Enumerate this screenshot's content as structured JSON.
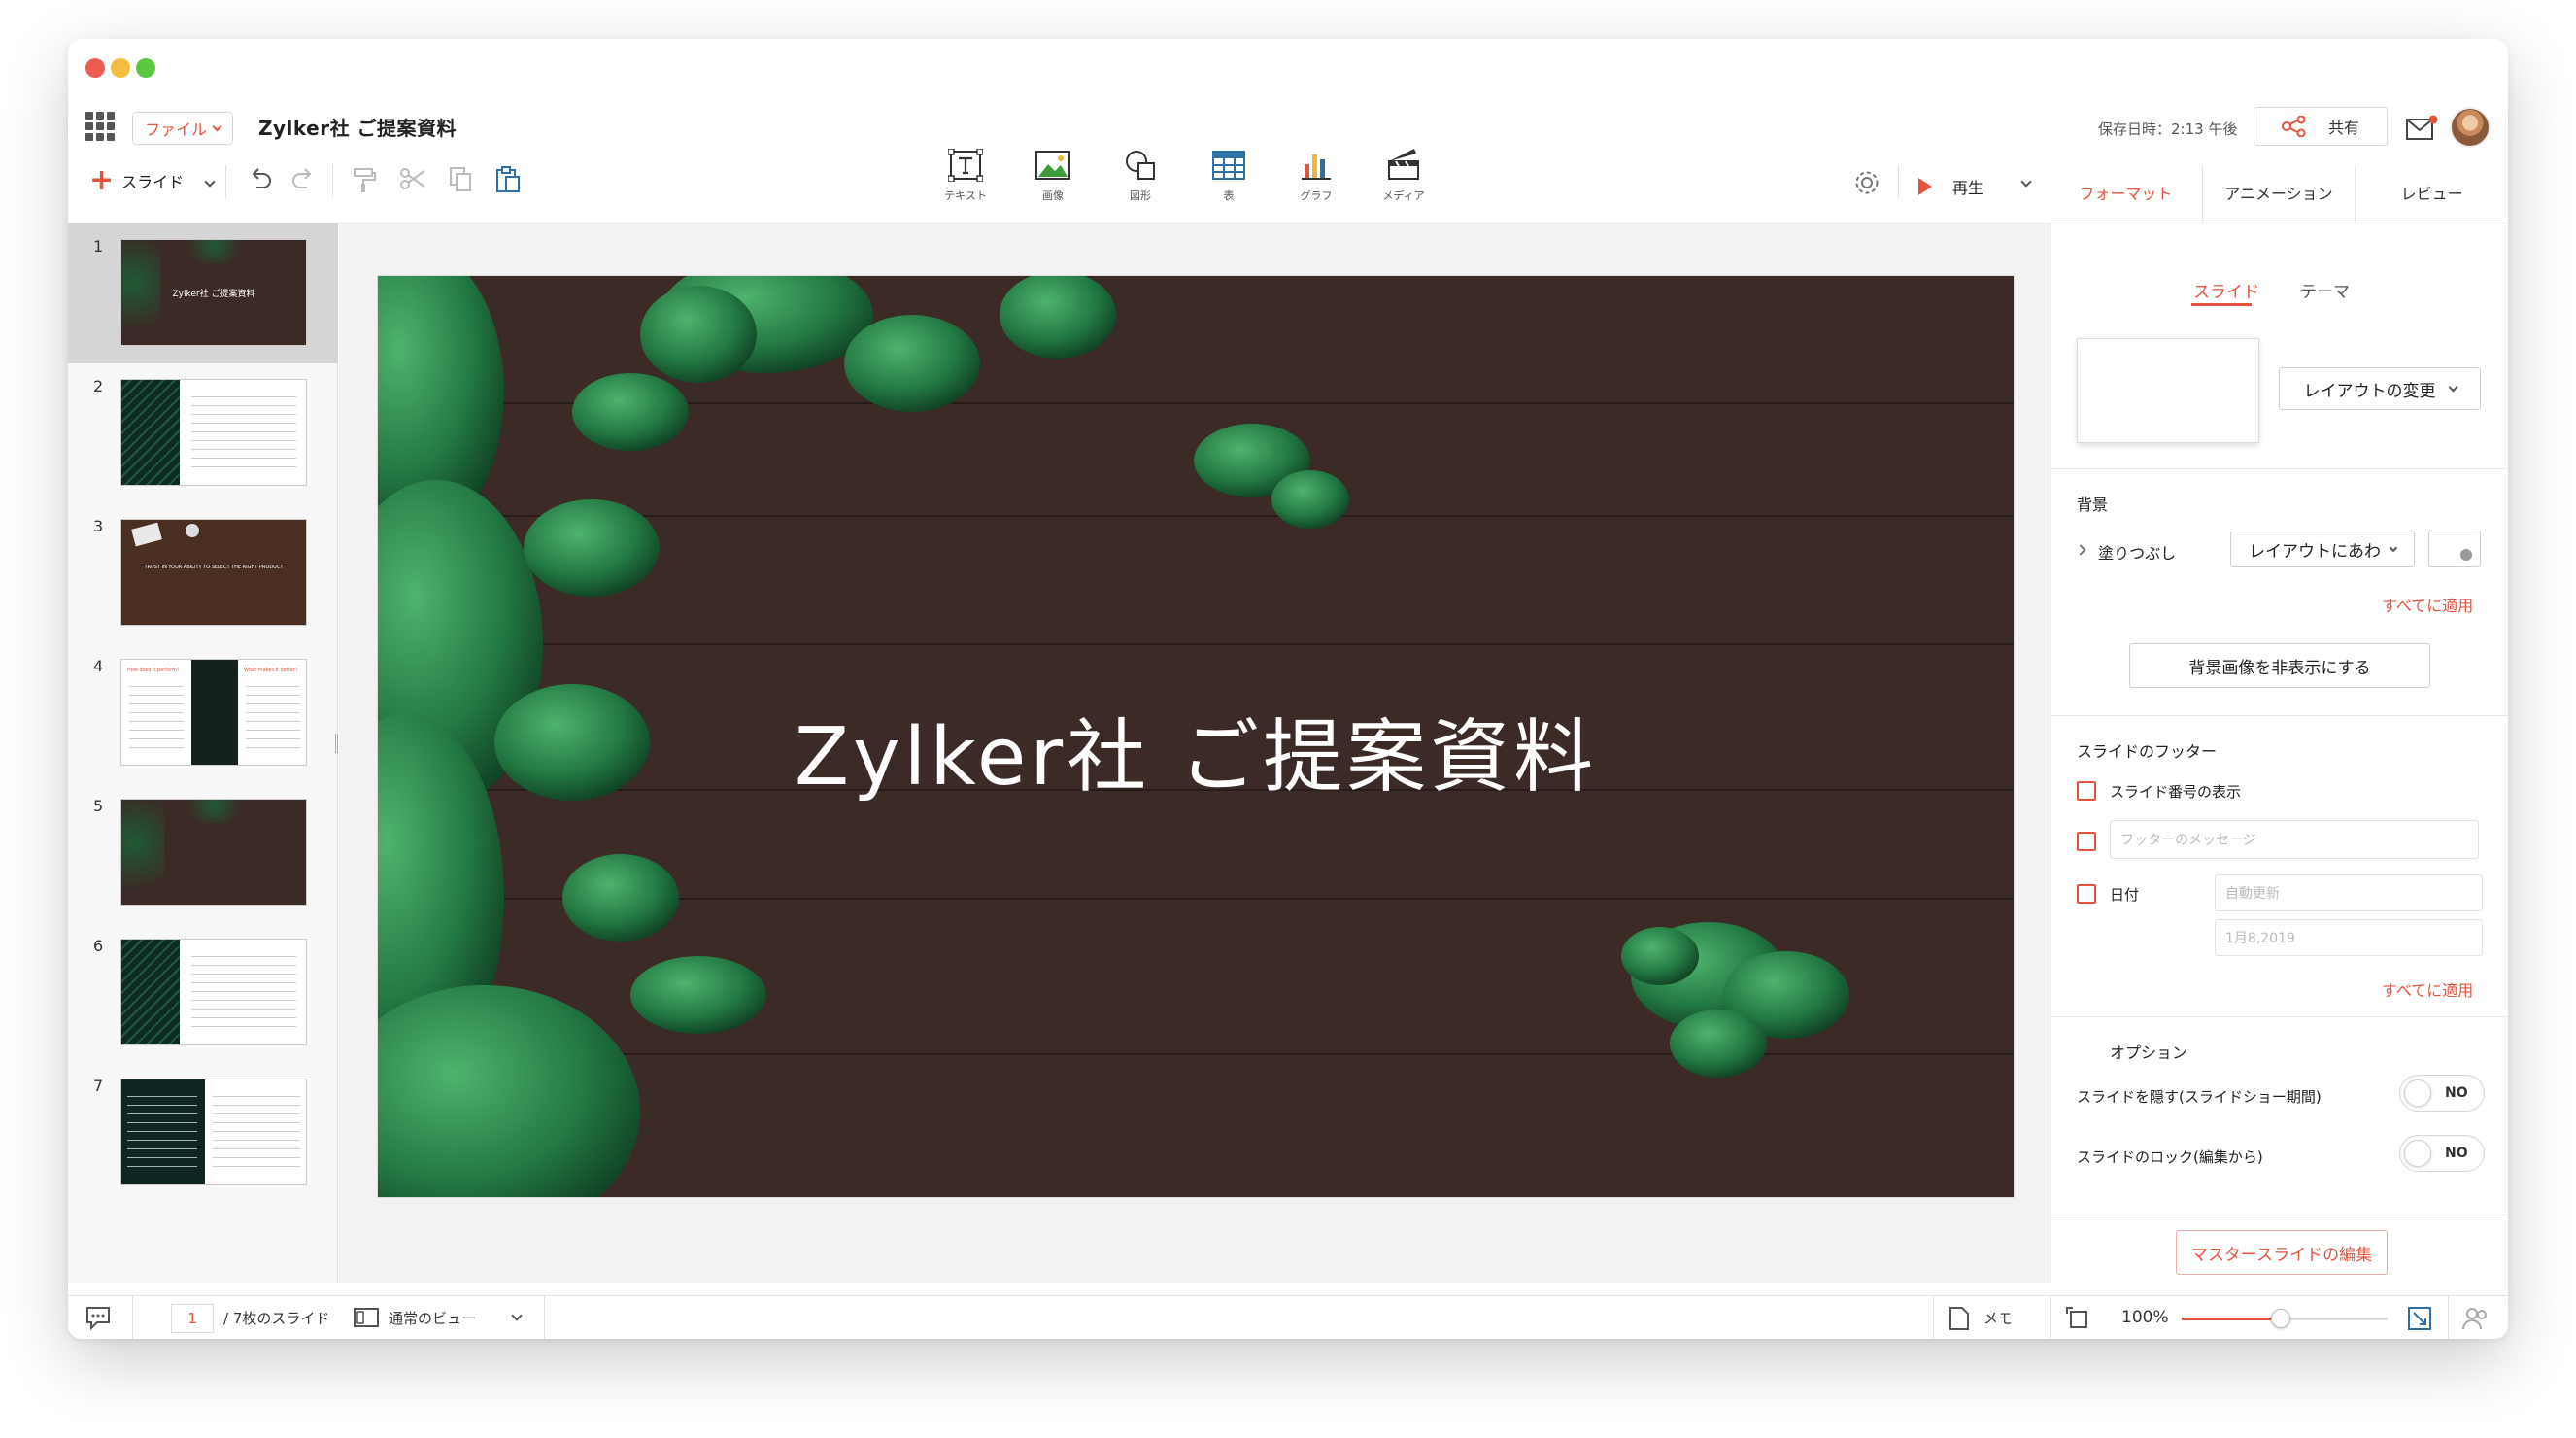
{
  "window": {
    "traffic": [
      "#ed5b52",
      "#f4bd3f",
      "#5ac83f"
    ]
  },
  "header": {
    "file_menu": "ファイル",
    "doc_title": "Zylker社 ご提案資料",
    "saved_text": "保存日時：2:13 午後",
    "share_label": "共有"
  },
  "toolbar": {
    "slide_label": "スライド",
    "insert": [
      {
        "label": "テキスト",
        "icon": "text-box-icon"
      },
      {
        "label": "画像",
        "icon": "image-icon"
      },
      {
        "label": "図形",
        "icon": "shapes-icon"
      },
      {
        "label": "表",
        "icon": "table-icon"
      },
      {
        "label": "グラフ",
        "icon": "chart-icon"
      },
      {
        "label": "メディア",
        "icon": "media-clapper-icon"
      }
    ],
    "play_label": "再生"
  },
  "panel_tabs": [
    "フォーマット",
    "アニメーション",
    "レビュー"
  ],
  "thumbnails": [
    "1",
    "2",
    "3",
    "4",
    "5",
    "6",
    "7"
  ],
  "thumb_text": {
    "t1": "Zylker社 ご提案資料",
    "t3": "TRUST IN YOUR ABILITY TO SELECT THE RIGHT PRODUCT",
    "t4a": "How does it perform?",
    "t4b": "What makes it better?"
  },
  "slide": {
    "title": "Zylker社 ご提案資料"
  },
  "format_panel": {
    "subtabs": [
      "スライド",
      "テーマ"
    ],
    "layout_change": "レイアウトの変更",
    "background_heading": "背景",
    "fill_label": "塗りつぶし",
    "fill_select": "レイアウトにあわ",
    "apply_all_1": "すべてに適用",
    "hide_bg_button": "背景画像を非表示にする",
    "footer_heading": "スライドのフッター",
    "show_slide_number": "スライド番号の表示",
    "footer_message_placeholder": "フッターのメッセージ",
    "date_label": "日付",
    "date_mode": "自動更新",
    "date_value": "1月8,2019",
    "apply_all_2": "すべてに適用",
    "options_heading": "オプション",
    "hide_slide_label": "スライドを隠す(スライドショー期間)",
    "hide_slide_value": "NO",
    "lock_slide_label": "スライドのロック(編集から)",
    "lock_slide_value": "NO",
    "master_edit_button": "マスタースライドの編集"
  },
  "statusbar": {
    "page_number": "1",
    "total_slides": "/ 7枚のスライド",
    "view_mode": "通常のビュー",
    "notes_label": "メモ",
    "zoom": "100%",
    "zoom_fraction": 0.48
  },
  "colors": {
    "accent": "#e5533d"
  }
}
